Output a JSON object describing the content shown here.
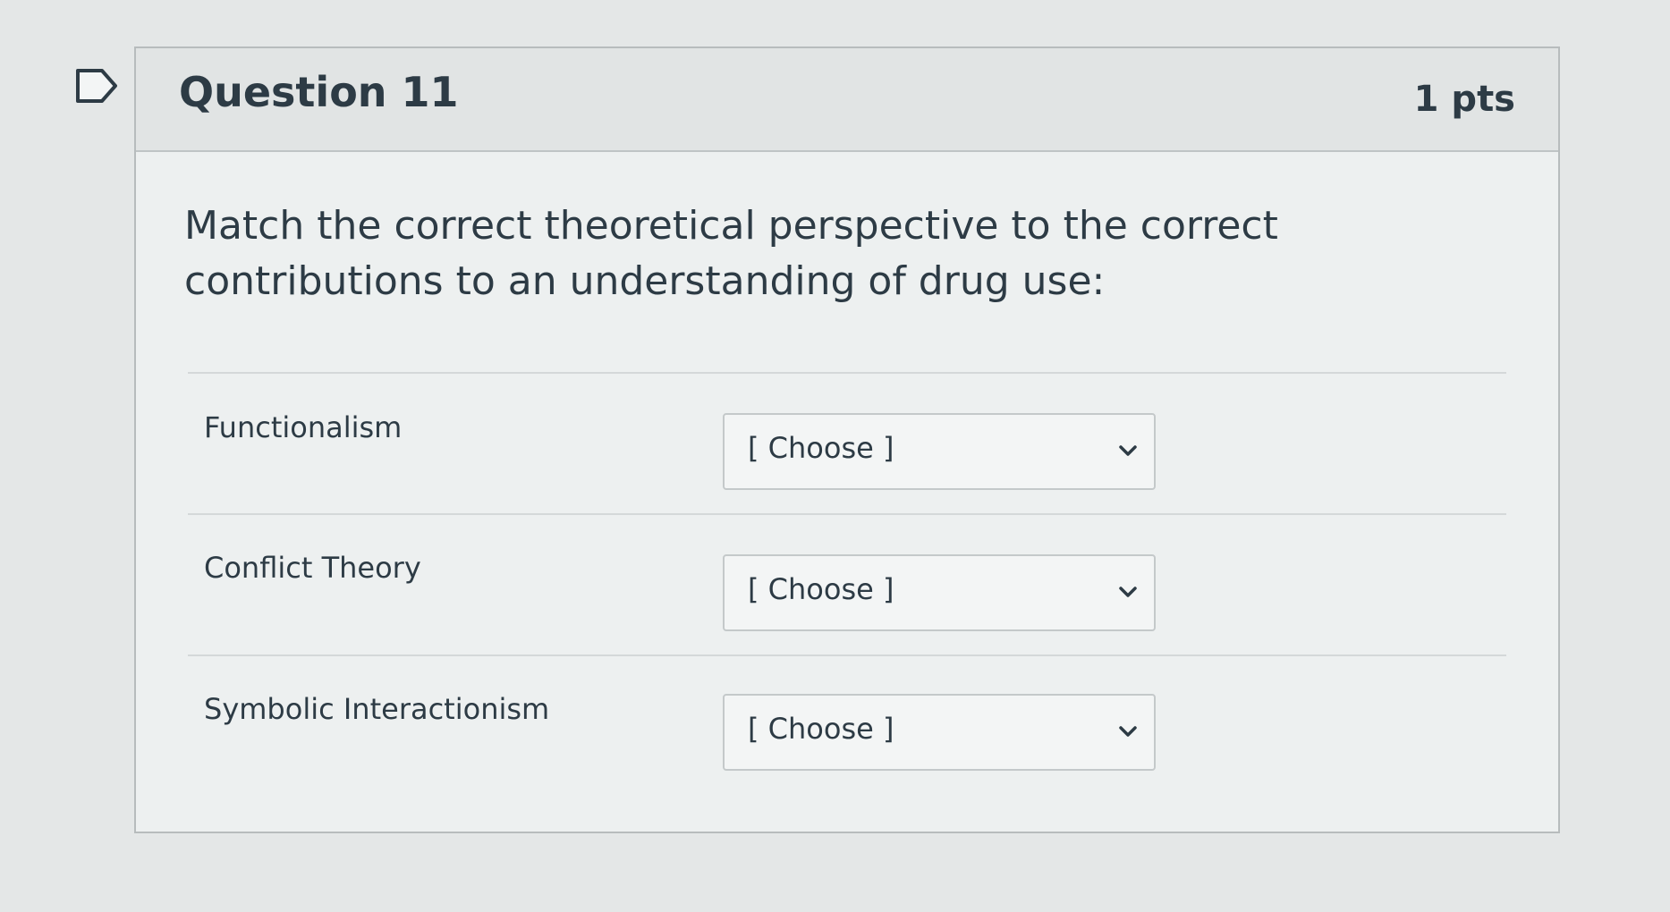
{
  "question": {
    "title": "Question 11",
    "points": "1 pts",
    "prompt": "Match the correct theoretical perspective to the correct contributions to an understanding of drug use:"
  },
  "matches": [
    {
      "label": "Functionalism",
      "selected": "[ Choose ]"
    },
    {
      "label": "Conflict Theory",
      "selected": "[ Choose ]"
    },
    {
      "label": "Symbolic Interactionism",
      "selected": "[ Choose ]"
    }
  ],
  "icons": {
    "bookmark": "bookmark-flag-icon",
    "dropdown": "chevron-down-icon"
  },
  "colors": {
    "text": "#2d3b45",
    "header_bg": "#e1e4e4",
    "border": "#b7bcbd"
  }
}
